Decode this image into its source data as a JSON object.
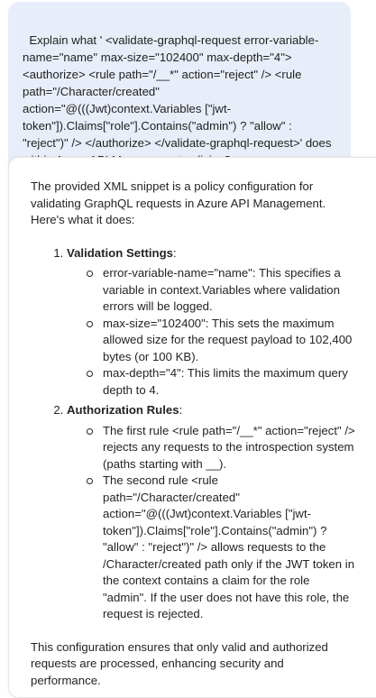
{
  "user_message": {
    "text": "Explain what ' <validate-graphql-request error-variable-name=\"name\" max-size=\"102400\" max-depth=\"4\"> <authorize> <rule path=\"/__*\" action=\"reject\" /> <rule path=\"/Character/created\" action=\"@(((Jwt)context.Variables [\"jwt-token\"]).Claims[\"role\"].Contains(\"admin\") ? \"allow\" : \"reject\")\" /> </authorize> </validate-graphql-request>' does within Azure API Management policies?"
  },
  "assistant_message": {
    "intro": "The provided XML snippet is a policy configuration for validating GraphQL requests in Azure API Management. Here's what it does:",
    "sections": [
      {
        "title": "Validation Settings",
        "bullets": [
          "error-variable-name=\"name\": This specifies a variable in context.Variables where validation errors will be logged.",
          "max-size=\"102400\": This sets the maximum allowed size for the request payload to 102,400 bytes (or 100 KB).",
          "max-depth=\"4\": This limits the maximum query depth to 4."
        ]
      },
      {
        "title": "Authorization Rules",
        "bullets": [
          "The first rule <rule path=\"/__*\" action=\"reject\" /> rejects any requests to the introspection system (paths starting with __).",
          "The second rule <rule path=\"/Character/created\" action=\"@(((Jwt)context.Variables [\"jwt-token\"]).Claims[\"role\"].Contains(\"admin\") ? \"allow\" : \"reject\")\" /> allows requests to the /Character/created path only if the JWT token in the context contains a claim for the role \"admin\". If the user does not have this role, the request is rejected."
        ]
      }
    ],
    "outro": "This configuration ensures that only valid and authorized requests are processed, enhancing security and performance."
  },
  "colors": {
    "user_bubble_bg": "#e8eef9",
    "text": "#242424"
  }
}
